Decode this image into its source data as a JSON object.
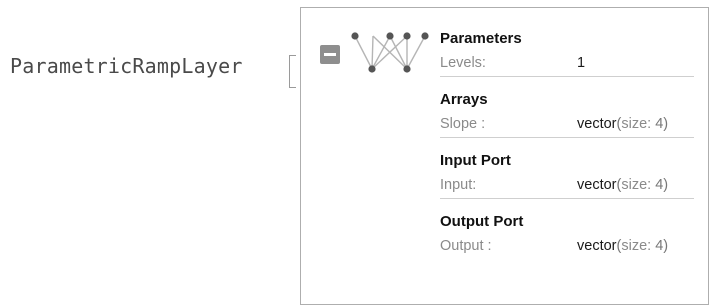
{
  "expression": {
    "head": "ParametricRampLayer"
  },
  "icons": {
    "collapse": "collapse-minus-icon",
    "network": "neural-network-icon"
  },
  "sections": [
    {
      "title": "Parameters",
      "rows": [
        {
          "key": "Levels:",
          "value": "1"
        }
      ]
    },
    {
      "title": "Arrays",
      "rows": [
        {
          "key": "Slope :",
          "type": "vector",
          "size_label": "size:",
          "size": "4"
        }
      ]
    },
    {
      "title": "Input Port",
      "rows": [
        {
          "key": "Input:",
          "type": "vector",
          "size_label": "size:",
          "size": "4"
        }
      ]
    },
    {
      "title": "Output Port",
      "rows": [
        {
          "key": "Output :",
          "type": "vector",
          "size_label": "size:",
          "size": "4"
        }
      ]
    }
  ],
  "colors": {
    "panel_border": "#aeaeae",
    "button": "#8e8e8e",
    "node": "#555555",
    "edge": "#b5b5b5"
  }
}
